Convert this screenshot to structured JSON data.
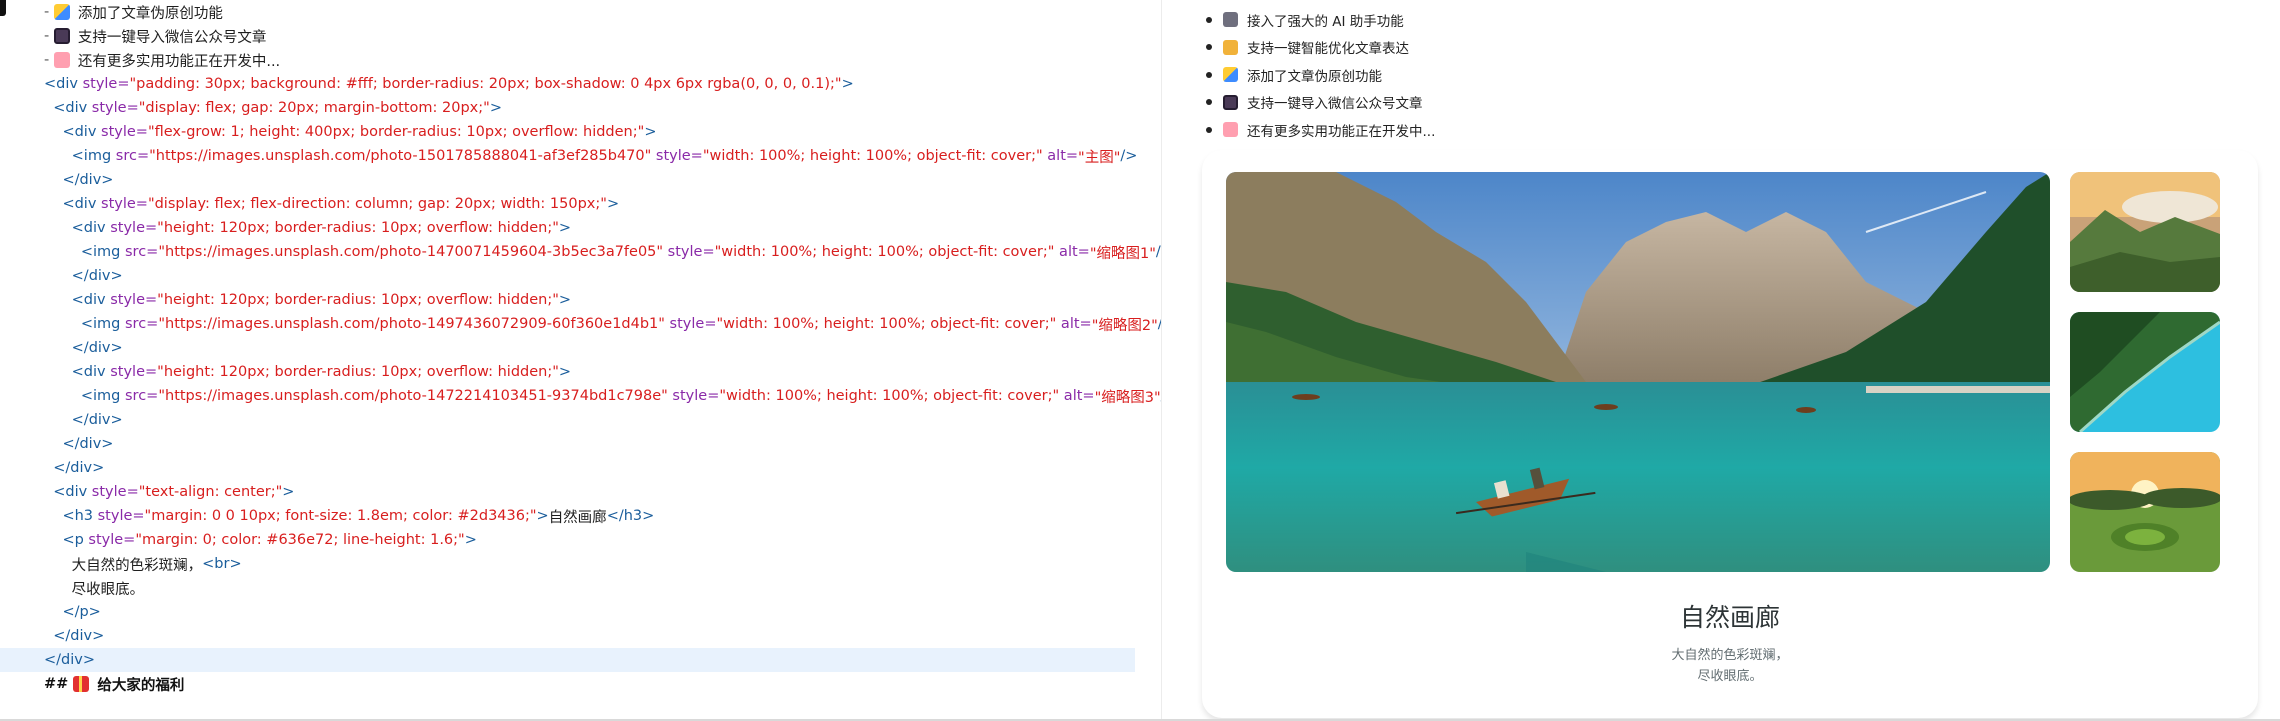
{
  "editor": {
    "lines": [
      [
        {
          "c": "t-md",
          "t": "- "
        },
        {
          "icon": "em-pen"
        },
        {
          "c": "t-txt",
          "t": "添加了文章伪原创功能"
        }
      ],
      [
        {
          "c": "t-md",
          "t": "- "
        },
        {
          "icon": "em-phone"
        },
        {
          "c": "t-txt",
          "t": "支持一键导入微信公众号文章"
        }
      ],
      [
        {
          "c": "t-md",
          "t": "- "
        },
        {
          "icon": "em-brain"
        },
        {
          "c": "t-txt",
          "t": "还有更多实用功能正在开发中..."
        }
      ],
      [
        {
          "c": "t-tag",
          "t": "<div "
        },
        {
          "c": "t-attr",
          "t": "style="
        },
        {
          "c": "t-val",
          "t": "\"padding: 30px; background: #fff; border-radius: 20px; box-shadow: 0 4px 6px rgba(0, 0, 0, 0.1);\""
        },
        {
          "c": "t-tag",
          "t": ">"
        }
      ],
      [
        {
          "c": "t-txt",
          "t": "  "
        },
        {
          "c": "t-tag",
          "t": "<div "
        },
        {
          "c": "t-attr",
          "t": "style="
        },
        {
          "c": "t-val",
          "t": "\"display: flex; gap: 20px; margin-bottom: 20px;\""
        },
        {
          "c": "t-tag",
          "t": ">"
        }
      ],
      [
        {
          "c": "t-txt",
          "t": "    "
        },
        {
          "c": "t-tag",
          "t": "<div "
        },
        {
          "c": "t-attr",
          "t": "style="
        },
        {
          "c": "t-val",
          "t": "\"flex-grow: 1; height: 400px; border-radius: 10px; overflow: hidden;\""
        },
        {
          "c": "t-tag",
          "t": ">"
        }
      ],
      [
        {
          "c": "t-txt",
          "t": "      "
        },
        {
          "c": "t-tag",
          "t": "<img "
        },
        {
          "c": "t-attr",
          "t": "src="
        },
        {
          "c": "t-val",
          "t": "\"https://images.unsplash.com/photo-1501785888041-af3ef285b470\""
        },
        {
          "c": "t-attr",
          "t": " style="
        },
        {
          "c": "t-val",
          "t": "\"width: 100%; height: 100%; object-fit: cover;\""
        },
        {
          "c": "t-attr",
          "t": " alt="
        },
        {
          "c": "t-val",
          "t": "\"主图\""
        },
        {
          "c": "t-tag",
          "t": "/>"
        }
      ],
      [
        {
          "c": "t-txt",
          "t": "    "
        },
        {
          "c": "t-tag",
          "t": "</div>"
        }
      ],
      [
        {
          "c": "t-txt",
          "t": "    "
        },
        {
          "c": "t-tag",
          "t": "<div "
        },
        {
          "c": "t-attr",
          "t": "style="
        },
        {
          "c": "t-val",
          "t": "\"display: flex; flex-direction: column; gap: 20px; width: 150px;\""
        },
        {
          "c": "t-tag",
          "t": ">"
        }
      ],
      [
        {
          "c": "t-txt",
          "t": "      "
        },
        {
          "c": "t-tag",
          "t": "<div "
        },
        {
          "c": "t-attr",
          "t": "style="
        },
        {
          "c": "t-val",
          "t": "\"height: 120px; border-radius: 10px; overflow: hidden;\""
        },
        {
          "c": "t-tag",
          "t": ">"
        }
      ],
      [
        {
          "c": "t-txt",
          "t": "        "
        },
        {
          "c": "t-tag",
          "t": "<img "
        },
        {
          "c": "t-attr",
          "t": "src="
        },
        {
          "c": "t-val",
          "t": "\"https://images.unsplash.com/photo-1470071459604-3b5ec3a7fe05\""
        },
        {
          "c": "t-attr",
          "t": " style="
        },
        {
          "c": "t-val",
          "t": "\"width: 100%; height: 100%; object-fit: cover;\""
        },
        {
          "c": "t-attr",
          "t": " alt="
        },
        {
          "c": "t-val",
          "t": "\"缩略图1\""
        },
        {
          "c": "t-tag",
          "t": "/>"
        }
      ],
      [
        {
          "c": "t-txt",
          "t": "      "
        },
        {
          "c": "t-tag",
          "t": "</div>"
        }
      ],
      [
        {
          "c": "t-txt",
          "t": "      "
        },
        {
          "c": "t-tag",
          "t": "<div "
        },
        {
          "c": "t-attr",
          "t": "style="
        },
        {
          "c": "t-val",
          "t": "\"height: 120px; border-radius: 10px; overflow: hidden;\""
        },
        {
          "c": "t-tag",
          "t": ">"
        }
      ],
      [
        {
          "c": "t-txt",
          "t": "        "
        },
        {
          "c": "t-tag",
          "t": "<img "
        },
        {
          "c": "t-attr",
          "t": "src="
        },
        {
          "c": "t-val",
          "t": "\"https://images.unsplash.com/photo-1497436072909-60f360e1d4b1\""
        },
        {
          "c": "t-attr",
          "t": " style="
        },
        {
          "c": "t-val",
          "t": "\"width: 100%; height: 100%; object-fit: cover;\""
        },
        {
          "c": "t-attr",
          "t": " alt="
        },
        {
          "c": "t-val",
          "t": "\"缩略图2\""
        },
        {
          "c": "t-tag",
          "t": "/>"
        }
      ],
      [
        {
          "c": "t-txt",
          "t": "      "
        },
        {
          "c": "t-tag",
          "t": "</div>"
        }
      ],
      [
        {
          "c": "t-txt",
          "t": "      "
        },
        {
          "c": "t-tag",
          "t": "<div "
        },
        {
          "c": "t-attr",
          "t": "style="
        },
        {
          "c": "t-val",
          "t": "\"height: 120px; border-radius: 10px; overflow: hidden;\""
        },
        {
          "c": "t-tag",
          "t": ">"
        }
      ],
      [
        {
          "c": "t-txt",
          "t": "        "
        },
        {
          "c": "t-tag",
          "t": "<img "
        },
        {
          "c": "t-attr",
          "t": "src="
        },
        {
          "c": "t-val",
          "t": "\"https://images.unsplash.com/photo-1472214103451-9374bd1c798e\""
        },
        {
          "c": "t-attr",
          "t": " style="
        },
        {
          "c": "t-val",
          "t": "\"width: 100%; height: 100%; object-fit: cover;\""
        },
        {
          "c": "t-attr",
          "t": " alt="
        },
        {
          "c": "t-val",
          "t": "\"缩略图3\""
        },
        {
          "c": "t-tag",
          "t": "/>"
        }
      ],
      [
        {
          "c": "t-txt",
          "t": "      "
        },
        {
          "c": "t-tag",
          "t": "</div>"
        }
      ],
      [
        {
          "c": "t-txt",
          "t": "    "
        },
        {
          "c": "t-tag",
          "t": "</div>"
        }
      ],
      [
        {
          "c": "t-txt",
          "t": "  "
        },
        {
          "c": "t-tag",
          "t": "</div>"
        }
      ],
      [
        {
          "c": "t-txt",
          "t": "  "
        },
        {
          "c": "t-tag",
          "t": "<div "
        },
        {
          "c": "t-attr",
          "t": "style="
        },
        {
          "c": "t-val",
          "t": "\"text-align: center;\""
        },
        {
          "c": "t-tag",
          "t": ">"
        }
      ],
      [
        {
          "c": "t-txt",
          "t": "    "
        },
        {
          "c": "t-tag",
          "t": "<h3 "
        },
        {
          "c": "t-attr",
          "t": "style="
        },
        {
          "c": "t-val",
          "t": "\"margin: 0 0 10px; font-size: 1.8em; color: #2d3436;\""
        },
        {
          "c": "t-tag",
          "t": ">"
        },
        {
          "c": "t-txt",
          "t": "自然画廊"
        },
        {
          "c": "t-tag",
          "t": "</h3>"
        }
      ],
      [
        {
          "c": "t-txt",
          "t": "    "
        },
        {
          "c": "t-tag",
          "t": "<p "
        },
        {
          "c": "t-attr",
          "t": "style="
        },
        {
          "c": "t-val",
          "t": "\"margin: 0; color: #636e72; line-height: 1.6;\""
        },
        {
          "c": "t-tag",
          "t": ">"
        }
      ],
      [
        {
          "c": "t-txt",
          "t": "      大自然的色彩斑斓，"
        },
        {
          "c": "t-tag",
          "t": "<br>"
        }
      ],
      [
        {
          "c": "t-txt",
          "t": "      尽收眼底。"
        }
      ],
      [
        {
          "c": "t-txt",
          "t": "    "
        },
        {
          "c": "t-tag",
          "t": "</p>"
        }
      ],
      [
        {
          "c": "t-txt",
          "t": "  "
        },
        {
          "c": "t-tag",
          "t": "</div>"
        }
      ],
      [
        {
          "c": "t-tag",
          "t": "</div>"
        }
      ],
      [
        {
          "c": "t-bold",
          "t": "## "
        },
        {
          "icon": "em-gift"
        },
        {
          "c": "t-bold",
          "t": "给大家的福利"
        }
      ]
    ]
  },
  "preview": {
    "bullets": [
      {
        "icon": "bi-robot",
        "text": "接入了强大的 AI 助手功能"
      },
      {
        "icon": "bi-hand",
        "text": "支持一键智能优化文章表达"
      },
      {
        "icon": "em-pen",
        "text": "添加了文章伪原创功能"
      },
      {
        "icon": "em-phone",
        "text": "支持一键导入微信公众号文章"
      },
      {
        "icon": "em-brain",
        "text": "还有更多实用功能正在开发中..."
      }
    ],
    "gallery": {
      "title": "自然画廊",
      "line1": "大自然的色彩斑斓，",
      "line2": "尽收眼底。"
    }
  }
}
